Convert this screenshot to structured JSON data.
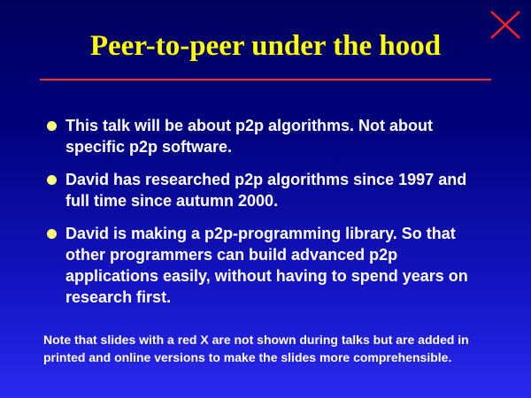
{
  "slide": {
    "title": "Peer-to-peer under the hood",
    "bullets": [
      "This talk will be about p2p algorithms. Not about specific p2p software.",
      "David has researched p2p algorithms since 1997 and full time since autumn 2000.",
      "David is making a p2p-programming library. So that other programmers can build advanced p2p applications easily, without having to spend years on research first."
    ],
    "note": "Note that slides with a red X are not shown during talks but are added in printed and online versions to make the slides more comprehensible."
  },
  "colors": {
    "background_top": "#00005c",
    "background_bottom": "#2a2af0",
    "title": "#ffff00",
    "rule": "#ff2b2b",
    "bullet": "#ffff7a",
    "close_x": "#ff2020",
    "text": "#ffffff"
  },
  "icons": {
    "close": "close-icon",
    "bullet": "bullet-dot-icon"
  }
}
